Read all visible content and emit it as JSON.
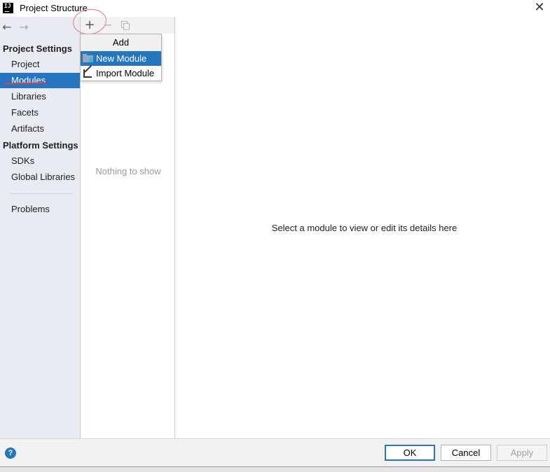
{
  "window": {
    "title": "Project Structure",
    "logo_text": "IJ",
    "close_glyph": "✕"
  },
  "nav": {
    "back_glyph": "←",
    "forward_glyph": "→"
  },
  "sidebar": {
    "project_settings_header": "Project Settings",
    "platform_settings_header": "Platform Settings",
    "items": [
      {
        "label": "Project"
      },
      {
        "label": "Modules",
        "selected": true
      },
      {
        "label": "Libraries"
      },
      {
        "label": "Facets"
      },
      {
        "label": "Artifacts"
      },
      {
        "label": "SDKs"
      },
      {
        "label": "Global Libraries"
      },
      {
        "label": "Problems"
      }
    ]
  },
  "list": {
    "add_glyph": "+",
    "remove_glyph": "−",
    "empty_text": "Nothing to show"
  },
  "popup": {
    "header": "Add",
    "items": [
      {
        "label": "New Module",
        "icon": "folder-module-icon",
        "selected": true
      },
      {
        "label": "Import Module",
        "icon": "import-arrow-icon"
      }
    ]
  },
  "content": {
    "message": "Select a module to view or edit its details here"
  },
  "footer": {
    "help_glyph": "?",
    "ok_label": "OK",
    "cancel_label": "Cancel",
    "apply_label": "Apply"
  },
  "colors": {
    "selection": "#2675bf",
    "annotation_red": "#d8424a"
  }
}
